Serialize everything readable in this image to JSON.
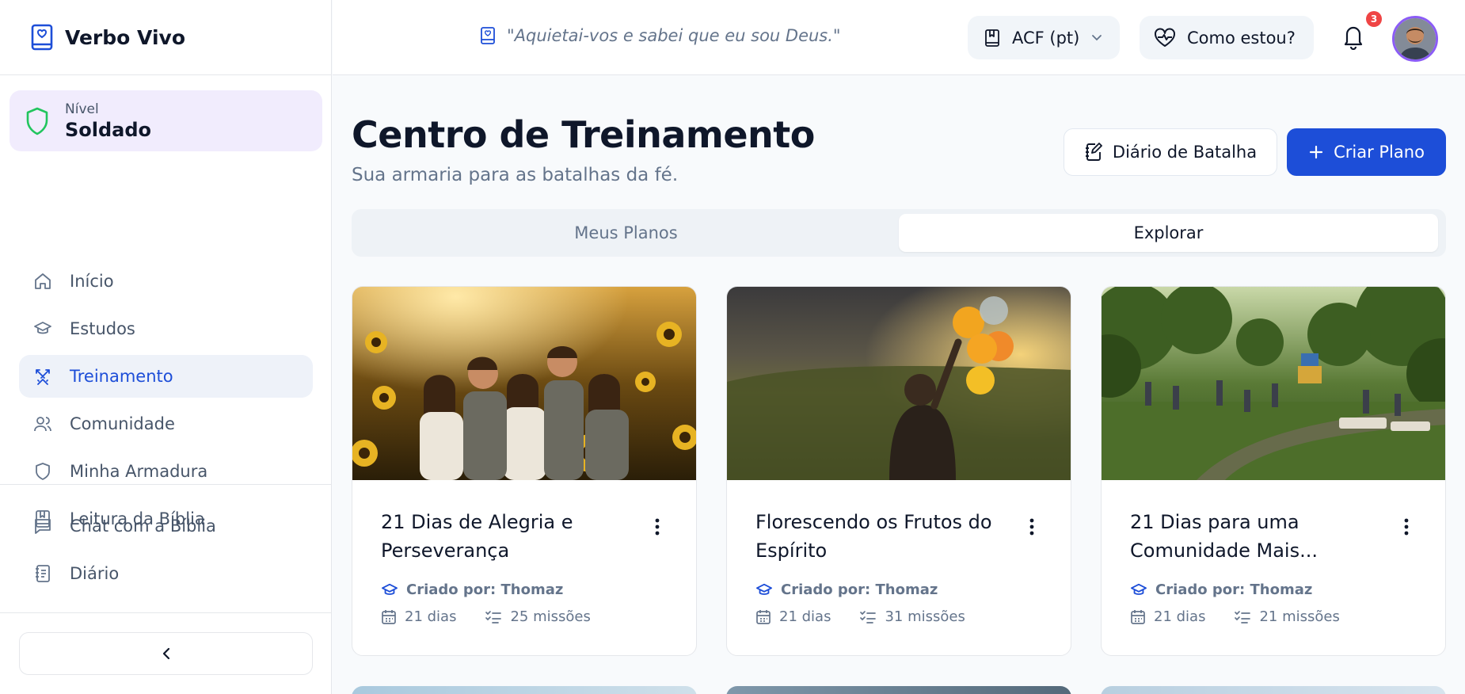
{
  "brand": {
    "name": "Verbo Vivo",
    "icon": "bible-book-icon"
  },
  "level": {
    "label": "Nível",
    "value": "Soldado",
    "icon": "shield-icon"
  },
  "sidebar": {
    "items": [
      {
        "label": "Início",
        "icon": "home-icon",
        "active": false
      },
      {
        "label": "Estudos",
        "icon": "graduation-cap-icon",
        "active": false
      },
      {
        "label": "Treinamento",
        "icon": "swords-icon",
        "active": true
      },
      {
        "label": "Comunidade",
        "icon": "users-icon",
        "active": false
      },
      {
        "label": "Minha Armadura",
        "icon": "shield-icon",
        "active": false
      },
      {
        "label": "Leitura da Bíblia",
        "icon": "book-icon",
        "active": false
      }
    ],
    "secondary": [
      {
        "label": "Chat com a Bíblia",
        "icon": "chat-icon"
      },
      {
        "label": "Diário",
        "icon": "notebook-icon"
      }
    ],
    "collapse_icon": "chevron-left-icon"
  },
  "header": {
    "verse": "\"Aquietai-vos e sabei que eu sou Deus.\"",
    "version": "ACF (pt)",
    "mood_button": "Como estou?",
    "notifications": "3"
  },
  "main": {
    "title": "Centro de Treinamento",
    "subtitle": "Sua armaria para as batalhas da fé.",
    "journal_button": "Diário de Batalha",
    "create_button": "Criar Plano",
    "tabs": [
      {
        "label": "Meus Planos",
        "active": false
      },
      {
        "label": "Explorar",
        "active": true
      }
    ],
    "plans": [
      {
        "title": "21 Dias de Alegria e Perseverança",
        "author": "Criado por: Thomaz",
        "days": "21 dias",
        "missions": "25 missões"
      },
      {
        "title": "Florescendo os Frutos do Espírito",
        "author": "Criado por: Thomaz",
        "days": "21 dias",
        "missions": "31 missões"
      },
      {
        "title": "21 Dias para uma Comunidade Mais...",
        "author": "Criado por: Thomaz",
        "days": "21 dias",
        "missions": "21 missões"
      }
    ]
  },
  "colors": {
    "accent": "#1d4ed8",
    "level_bg": "#f1ecfd",
    "shield": "#22c55e",
    "badge": "#ef4444"
  }
}
